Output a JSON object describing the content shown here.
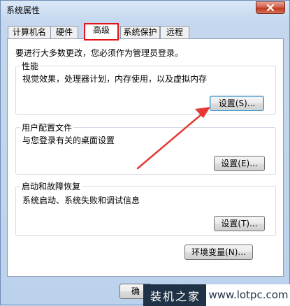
{
  "window": {
    "title": "系统属性"
  },
  "tabs": [
    {
      "label": "计算机名",
      "active": false
    },
    {
      "label": "硬件",
      "active": false
    },
    {
      "label": "高级",
      "active": true
    },
    {
      "label": "系统保护",
      "active": false
    },
    {
      "label": "远程",
      "active": false
    }
  ],
  "notice": "要进行大多数更改，您必须作为管理员登录。",
  "groups": {
    "performance": {
      "title": "性能",
      "desc": "视觉效果，处理器计划，内存使用，以及虚拟内存",
      "button": "设置(S)..."
    },
    "user_profiles": {
      "title": "用户配置文件",
      "desc": "与您登录有关的桌面设置",
      "button": "设置(E)..."
    },
    "startup_recovery": {
      "title": "启动和故障恢复",
      "desc": "系统启动、系统失败和调试信息",
      "button": "设置(T)..."
    }
  },
  "env_button": "环境变量(N)...",
  "ok_button": "确",
  "watermark": {
    "chinese": "装机之家",
    "url": "www.lotpc.com"
  },
  "colors": {
    "tab_highlight": "#e2141a",
    "arrow": "#e53935"
  },
  "icons": {
    "close": "close-icon"
  }
}
